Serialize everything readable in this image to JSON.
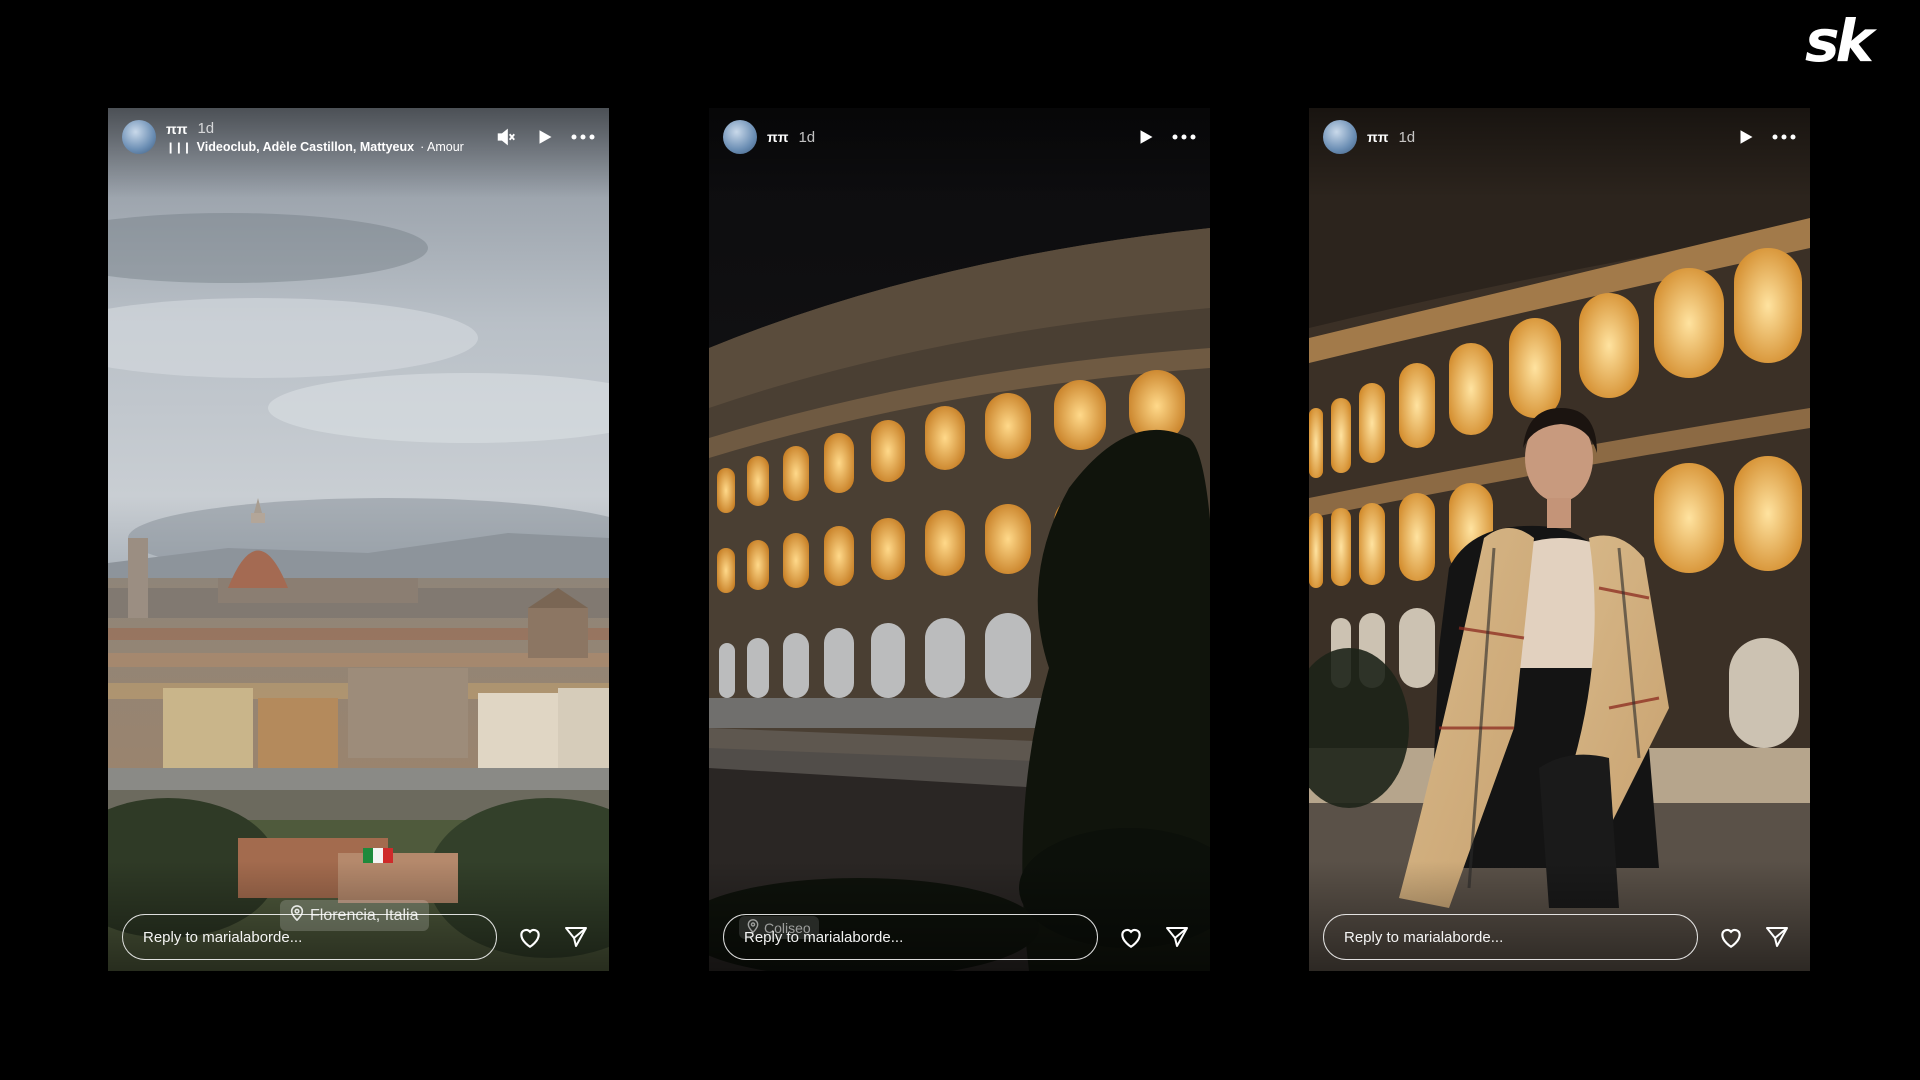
{
  "brand": {
    "logo_text": "sk"
  },
  "stories": [
    {
      "username": "ππ",
      "time": "1d",
      "music_artists": "Videoclub, Adèle Castillon, Mattyeux",
      "music_title": "· Amour pla",
      "location": "Florencia, Italia",
      "reply_placeholder": "Reply to marialaborde...",
      "icons": [
        "mute-icon",
        "play-icon",
        "more-icon",
        "heart-icon",
        "send-icon"
      ]
    },
    {
      "username": "ππ",
      "time": "1d",
      "location": "Coliseo",
      "reply_placeholder": "Reply to marialaborde...",
      "icons": [
        "play-icon",
        "more-icon",
        "heart-icon",
        "send-icon"
      ]
    },
    {
      "username": "ππ",
      "time": "1d",
      "reply_placeholder": "Reply to marialaborde...",
      "icons": [
        "play-icon",
        "more-icon",
        "heart-icon",
        "send-icon"
      ]
    }
  ],
  "colors": {
    "background": "#000000",
    "text": "#ffffff",
    "arch_light": "#f2b24a"
  }
}
